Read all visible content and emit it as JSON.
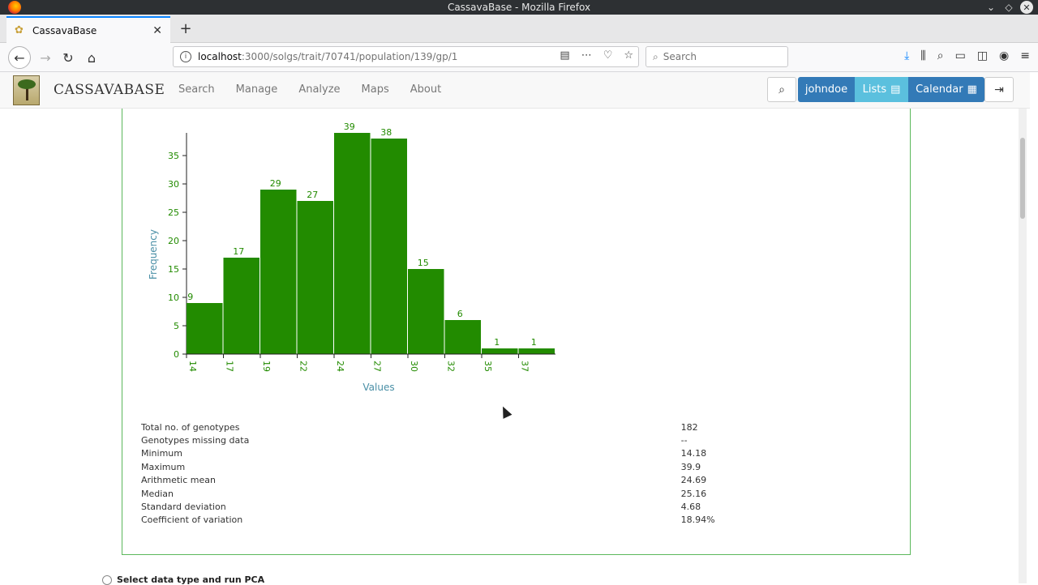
{
  "window": {
    "title": "CassavaBase - Mozilla Firefox"
  },
  "browser": {
    "tab_title": "CassavaBase",
    "url_host": "localhost",
    "url_path": ":3000/solgs/trait/70741/population/139/gp/1",
    "search_placeholder": "Search"
  },
  "site": {
    "brand": "CASSAVABASE",
    "menu": [
      "Search",
      "Manage",
      "Analyze",
      "Maps",
      "About"
    ],
    "user": "johndoe",
    "lists": "Lists",
    "calendar": "Calendar"
  },
  "chart_data": {
    "type": "bar",
    "title": "",
    "xlabel": "Values",
    "ylabel": "Frequency",
    "categories": [
      "14",
      "17",
      "19",
      "22",
      "24",
      "27",
      "30",
      "32",
      "35",
      "37",
      ""
    ],
    "x_tick_labels": [
      "14",
      "17",
      "19",
      "22",
      "24",
      "27",
      "30",
      "32",
      "35",
      "37"
    ],
    "values": [
      9,
      17,
      29,
      27,
      39,
      38,
      15,
      6,
      1,
      1
    ],
    "y_ticks": [
      0,
      5,
      10,
      15,
      20,
      25,
      30,
      35
    ],
    "ylim": [
      0,
      39
    ],
    "color": "#228b00"
  },
  "stats": [
    {
      "label": "Total no. of genotypes",
      "value": "182"
    },
    {
      "label": "Genotypes missing data",
      "value": "--"
    },
    {
      "label": "Minimum",
      "value": "14.18"
    },
    {
      "label": "Maximum",
      "value": "39.9"
    },
    {
      "label": "Arithmetic mean",
      "value": "24.69"
    },
    {
      "label": "Median",
      "value": "25.16"
    },
    {
      "label": "Standard deviation",
      "value": "4.68"
    },
    {
      "label": "Coefficient of variation",
      "value": "18.94%"
    }
  ],
  "pca": {
    "label": "Select data type and run PCA"
  }
}
